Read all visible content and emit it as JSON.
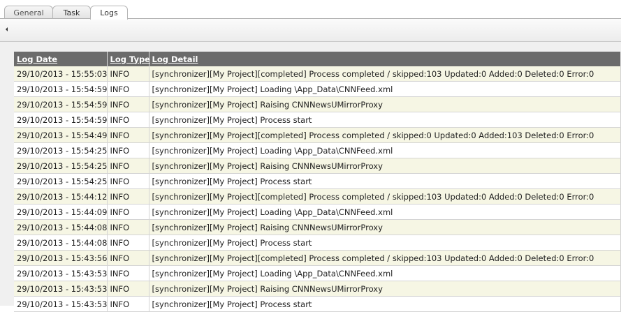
{
  "tabs": {
    "general": "General",
    "task": "Task",
    "logs": "Logs"
  },
  "table": {
    "headers": {
      "date": "Log Date",
      "type": "Log Type",
      "detail": "Log Detail"
    },
    "rows": [
      {
        "date": "29/10/2013 - 15:55:03",
        "type": "INFO",
        "detail": "[synchronizer][My Project][completed] Process completed / skipped:103 Updated:0 Added:0 Deleted:0 Error:0"
      },
      {
        "date": "29/10/2013 - 15:54:59",
        "type": "INFO",
        "detail": "[synchronizer][My Project] Loading \\App_Data\\CNNFeed.xml"
      },
      {
        "date": "29/10/2013 - 15:54:59",
        "type": "INFO",
        "detail": "[synchronizer][My Project] Raising CNNNewsUMirrorProxy"
      },
      {
        "date": "29/10/2013 - 15:54:59",
        "type": "INFO",
        "detail": "[synchronizer][My Project] Process start"
      },
      {
        "date": "29/10/2013 - 15:54:49",
        "type": "INFO",
        "detail": "[synchronizer][My Project][completed] Process completed / skipped:0 Updated:0 Added:103 Deleted:0 Error:0"
      },
      {
        "date": "29/10/2013 - 15:54:25",
        "type": "INFO",
        "detail": "[synchronizer][My Project] Loading \\App_Data\\CNNFeed.xml"
      },
      {
        "date": "29/10/2013 - 15:54:25",
        "type": "INFO",
        "detail": "[synchronizer][My Project] Raising CNNNewsUMirrorProxy"
      },
      {
        "date": "29/10/2013 - 15:54:25",
        "type": "INFO",
        "detail": "[synchronizer][My Project] Process start"
      },
      {
        "date": "29/10/2013 - 15:44:12",
        "type": "INFO",
        "detail": "[synchronizer][My Project][completed] Process completed / skipped:103 Updated:0 Added:0 Deleted:0 Error:0"
      },
      {
        "date": "29/10/2013 - 15:44:09",
        "type": "INFO",
        "detail": "[synchronizer][My Project] Loading \\App_Data\\CNNFeed.xml"
      },
      {
        "date": "29/10/2013 - 15:44:08",
        "type": "INFO",
        "detail": "[synchronizer][My Project] Raising CNNNewsUMirrorProxy"
      },
      {
        "date": "29/10/2013 - 15:44:08",
        "type": "INFO",
        "detail": "[synchronizer][My Project] Process start"
      },
      {
        "date": "29/10/2013 - 15:43:56",
        "type": "INFO",
        "detail": "[synchronizer][My Project][completed] Process completed / skipped:103 Updated:0 Added:0 Deleted:0 Error:0"
      },
      {
        "date": "29/10/2013 - 15:43:53",
        "type": "INFO",
        "detail": "[synchronizer][My Project] Loading \\App_Data\\CNNFeed.xml"
      },
      {
        "date": "29/10/2013 - 15:43:53",
        "type": "INFO",
        "detail": "[synchronizer][My Project] Raising CNNNewsUMirrorProxy"
      },
      {
        "date": "29/10/2013 - 15:43:53",
        "type": "INFO",
        "detail": "[synchronizer][My Project] Process start"
      }
    ]
  }
}
